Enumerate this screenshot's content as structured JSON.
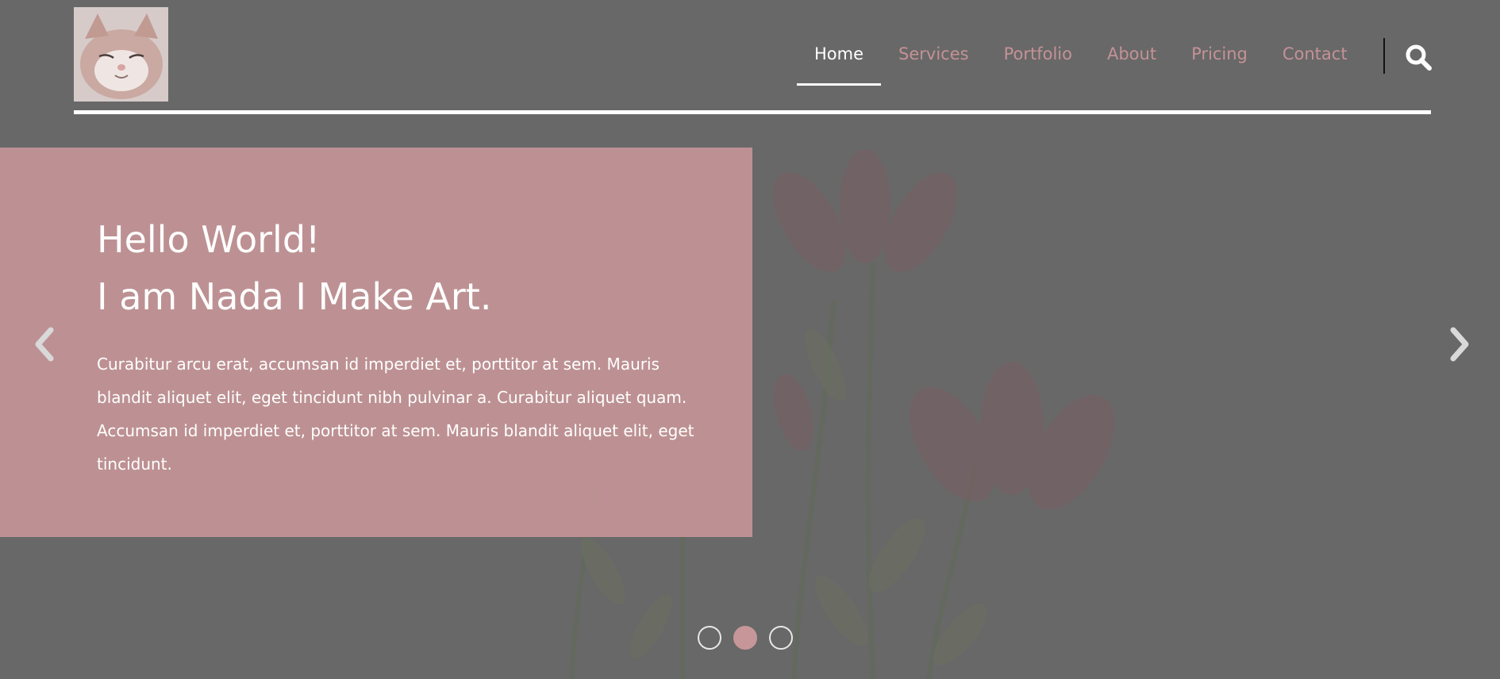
{
  "logo": {
    "alt": "cat-logo"
  },
  "nav": {
    "items": [
      {
        "label": "Home",
        "active": true
      },
      {
        "label": "Services",
        "active": false
      },
      {
        "label": "Portfolio",
        "active": false
      },
      {
        "label": "About",
        "active": false
      },
      {
        "label": "Pricing",
        "active": false
      },
      {
        "label": "Contact",
        "active": false
      }
    ],
    "search_icon": "search-icon"
  },
  "hero": {
    "title_line1": "Hello World!",
    "title_line2": "I am Nada I Make Art.",
    "text": "Curabitur arcu erat, accumsan id imperdiet et, porttitor at sem. Mauris blandit aliquet elit, eget tincidunt nibh pulvinar a. Curabitur aliquet quam. Accumsan id imperdiet et, porttitor at sem. Mauris blandit aliquet elit, eget tincidunt."
  },
  "carousel": {
    "prev_icon": "chevron-left-icon",
    "next_icon": "chevron-right-icon",
    "slide_count": 3,
    "active_slide": 2
  },
  "colors": {
    "accent": "#c79699",
    "nav_text": "#c49296",
    "overlay": "#686868"
  }
}
